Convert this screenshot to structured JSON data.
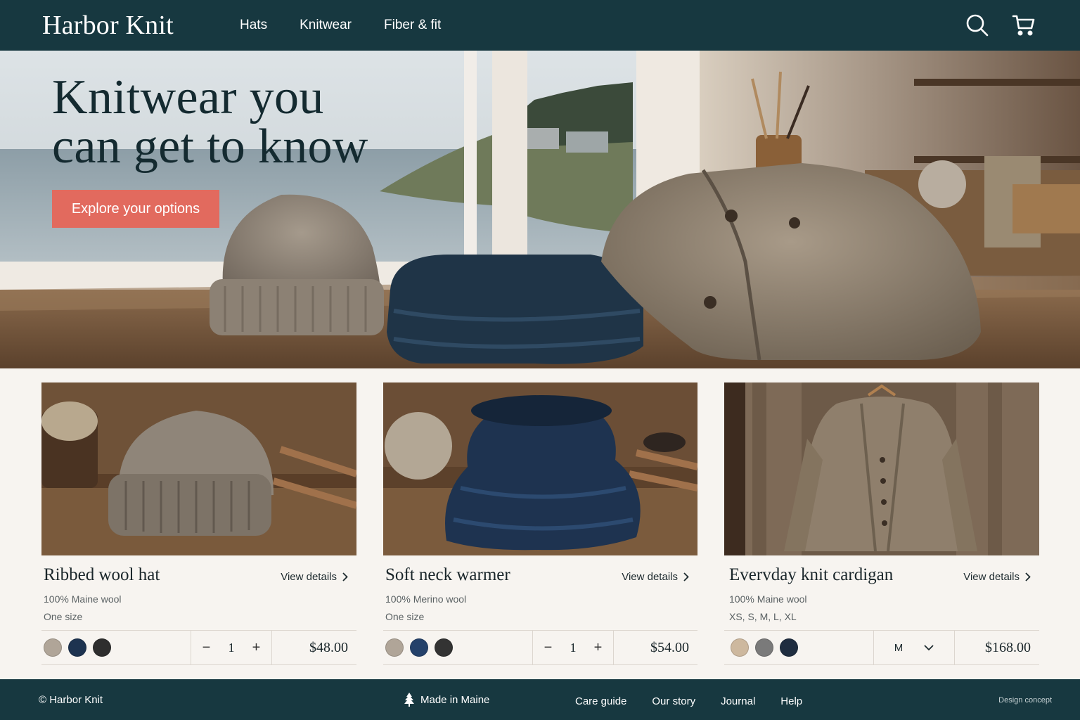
{
  "header": {
    "brand": "Harbor Knit",
    "nav": [
      "Hats",
      "Knitwear",
      "Fiber & fit"
    ],
    "icons": [
      "search-icon",
      "cart-icon"
    ]
  },
  "hero": {
    "title_line1": "Knitwear you",
    "title_line2": "can get to know",
    "cta_label": "Explore your options"
  },
  "products": [
    {
      "title": "Ribbed wool hat",
      "view_label": "View details",
      "material": "100% Maine wool",
      "size_info": "One size",
      "swatches": [
        "#b0a598",
        "#1d3350",
        "#2e2e2e"
      ],
      "quantity": "1",
      "price": "$48.00"
    },
    {
      "title": "Soft neck warmer",
      "view_label": "View details",
      "material": "100% Merino wool",
      "size_info": "One size",
      "swatches": [
        "#b0a598",
        "#24416a",
        "#333333"
      ],
      "quantity": "1",
      "price": "$54.00"
    },
    {
      "title": "Evervday knit cardigan",
      "view_label": "View details",
      "material": "100% Maine wool",
      "size_info": "XS, S, M, L, XL",
      "swatches": [
        "#cdb89e",
        "#7a7a7a",
        "#1f2d40"
      ],
      "size_selected": "M",
      "price": "$168.00"
    }
  ],
  "stepper": {
    "minus": "−",
    "plus": "+"
  },
  "footer": {
    "copyright": "© Harbor Knit",
    "made_in": "Made in Maine",
    "links": [
      "Care guide",
      "Our story",
      "Journal",
      "Help"
    ],
    "note": "Design concept"
  },
  "colors": {
    "header_bg": "#173840",
    "cta": "#e26a5e",
    "page_bg": "#f7f4f0"
  }
}
